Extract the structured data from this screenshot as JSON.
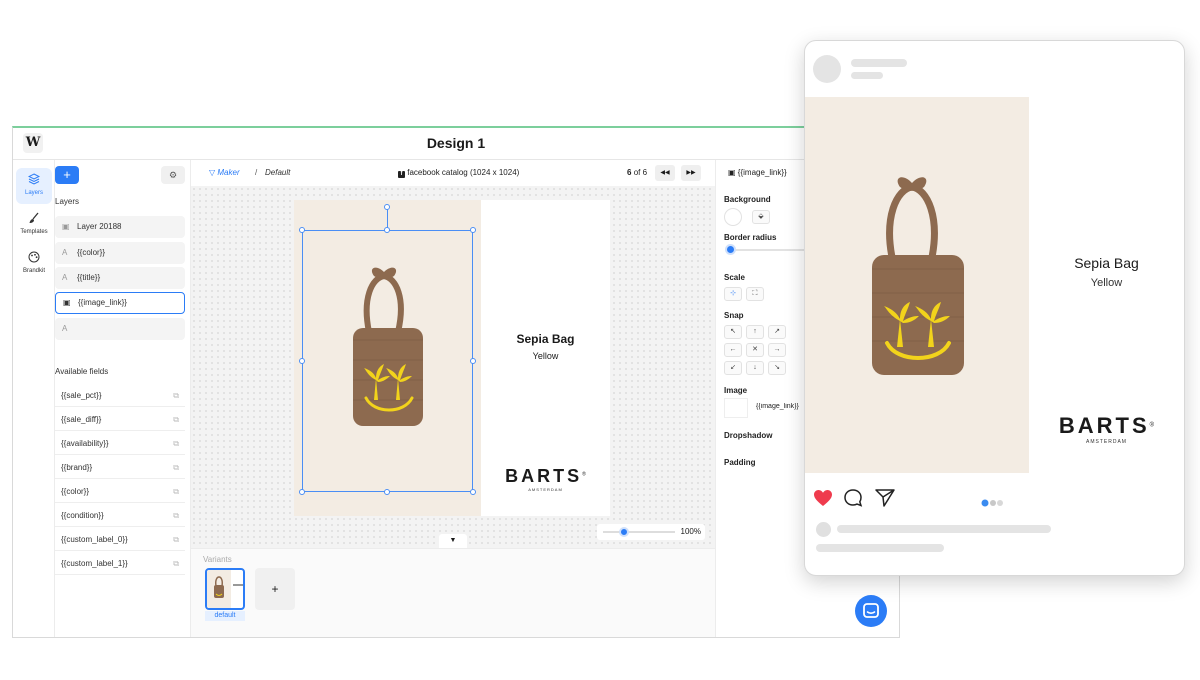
{
  "app": {
    "title": "Design 1",
    "logo": "W",
    "nav": [
      {
        "label": "Layers",
        "icon": "layers-icon"
      },
      {
        "label": "Templates",
        "icon": "brush-icon"
      },
      {
        "label": "Brandkit",
        "icon": "palette-icon"
      }
    ],
    "layers_panel": {
      "add_label": "+",
      "heading": "Layers",
      "items": [
        {
          "label": "Layer 20188",
          "icon": "image-icon"
        },
        {
          "label": "{{color}}",
          "icon": "text-icon"
        },
        {
          "label": "{{title}}",
          "icon": "text-icon"
        },
        {
          "label": "{{image_link}}",
          "icon": "image-icon"
        },
        {
          "label": "",
          "icon": "text-icon"
        }
      ],
      "fields_heading": "Available fields",
      "fields": [
        "{{sale_pct}}",
        "{{sale_diff}}",
        "{{availability}}",
        "{{brand}}",
        "{{color}}",
        "{{condition}}",
        "{{custom_label_0}}",
        "{{custom_label_1}}"
      ]
    },
    "toolbar": {
      "maker_label": "Maker",
      "separator": "/",
      "default_label": "Default",
      "format_label": "facebook catalog (1024 x 1024)",
      "page_current": "6",
      "page_text": "of 6",
      "prev_label": "◀◀",
      "next_label": "▶▶"
    },
    "artboard": {
      "product_title": "Sepia Bag",
      "product_color": "Yellow",
      "brand": "BARTS",
      "brand_sub": "AMSTERDAM",
      "brand_mark": "®"
    },
    "zoom": {
      "value": 100,
      "label": "100%"
    },
    "variants": {
      "heading": "Variants",
      "items": [
        {
          "label": "default"
        }
      ],
      "add_label": "+"
    },
    "props": {
      "title": "{{image_link}}",
      "background": "Background",
      "border_radius": "Border radius",
      "scale": "Scale",
      "snap": "Snap",
      "image": "Image",
      "image_value": "{{image_link}}",
      "dropshadow": "Dropshadow",
      "padding": "Padding",
      "snap_arrows": [
        "↖",
        "↑",
        "↗",
        "←",
        "✕",
        "→",
        "↙",
        "↓",
        "↘"
      ]
    }
  },
  "preview": {
    "product_title": "Sepia Bag",
    "product_color": "Yellow",
    "brand": "BARTS",
    "brand_sub": "AMSTERDAM",
    "brand_mark": "®",
    "carousel": {
      "current": 1,
      "total": 3
    }
  },
  "colors": {
    "accent": "#2b7cf6",
    "bag": "#8d6a4f",
    "sun": "#f2d31b",
    "like": "#ef3b4d",
    "canvas_bg": "#f3ece3"
  }
}
